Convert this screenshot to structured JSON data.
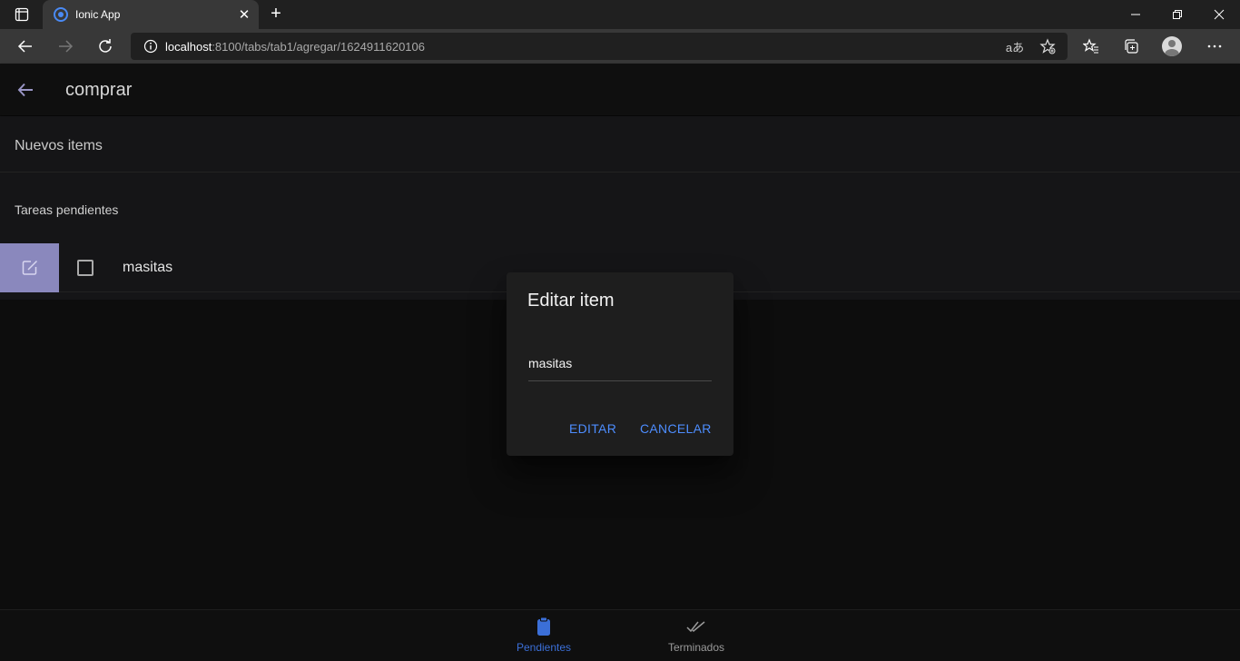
{
  "browser": {
    "tab_title": "Ionic App",
    "url_host": "localhost",
    "url_rest": ":8100/tabs/tab1/agregar/1624911620106",
    "read_aloud_icon_text": "aあ"
  },
  "app": {
    "header_title": "comprar",
    "new_items_label": "Nuevos items",
    "list_header": "Tareas pendientes",
    "tasks": [
      {
        "label": "masitas",
        "checked": false
      }
    ]
  },
  "dialog": {
    "title": "Editar item",
    "input_value": "masitas",
    "edit_button": "EDITAR",
    "cancel_button": "CANCELAR"
  },
  "tabs": [
    {
      "label": "Pendientes",
      "active": true
    },
    {
      "label": "Terminados",
      "active": false
    }
  ],
  "colors": {
    "accent": "#4d8dff",
    "edit_option_bg": "#8a88bd",
    "active_tab": "#3b6fd8",
    "inactive_tab": "#9a9a9a"
  }
}
